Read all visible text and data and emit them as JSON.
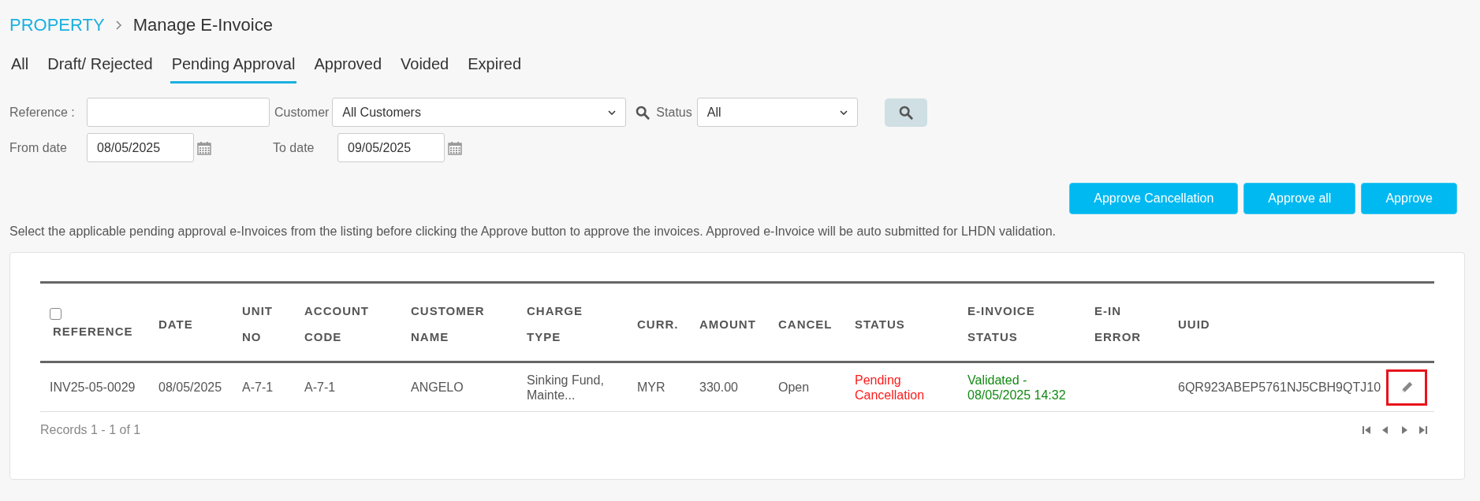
{
  "breadcrumb": {
    "root": "PROPERTY",
    "title": "Manage E-Invoice"
  },
  "tabs": [
    {
      "label": "All",
      "selected": false
    },
    {
      "label": "Draft/ Rejected",
      "selected": false
    },
    {
      "label": "Pending Approval",
      "selected": true
    },
    {
      "label": "Approved",
      "selected": false
    },
    {
      "label": "Voided",
      "selected": false
    },
    {
      "label": "Expired",
      "selected": false
    }
  ],
  "filters": {
    "reference": {
      "label": "Reference :"
    },
    "customer": {
      "label": "Customer",
      "value": "All Customers"
    },
    "status": {
      "label": "Status",
      "value": "All"
    },
    "from_date": {
      "label": "From date",
      "value": "08/05/2025"
    },
    "to_date": {
      "label": "To date",
      "value": "09/05/2025"
    }
  },
  "actions": [
    "Approve Cancellation",
    "Approve all",
    "Approve"
  ],
  "info_text": "Select the applicable pending approval e-Invoices from the listing before clicking the Approve button to approve the invoices. Approved e-Invoice will be auto submitted for LHDN validation.",
  "table": {
    "select_all": {
      "checked": false
    },
    "columns": [
      {
        "lines": [
          "REFERENCE"
        ]
      },
      {
        "lines": [
          "DATE"
        ]
      },
      {
        "lines": [
          "UNIT",
          "NO"
        ]
      },
      {
        "lines": [
          "ACCOUNT",
          "CODE"
        ]
      },
      {
        "lines": [
          "CUSTOMER",
          "NAME"
        ]
      },
      {
        "lines": [
          "CHARGE",
          "TYPE"
        ]
      },
      {
        "lines": [
          "CURR."
        ]
      },
      {
        "lines": [
          "AMOUNT"
        ]
      },
      {
        "lines": [
          "CANCEL"
        ]
      },
      {
        "lines": [
          "STATUS"
        ]
      },
      {
        "lines": [
          "E-INVOICE",
          "STATUS"
        ]
      },
      {
        "lines": [
          "E-IN",
          "ERROR"
        ]
      },
      {
        "lines": [
          "UUID"
        ]
      }
    ],
    "rows": [
      {
        "cells": [
          {
            "text": "INV25-05-0029"
          },
          {
            "text": "08/05/2025"
          },
          {
            "text": "A-7-1"
          },
          {
            "text": "A-7-1"
          },
          {
            "text": "ANGELO"
          },
          {
            "text": "Sinking Fund, Mainte..."
          },
          {
            "text": "MYR"
          },
          {
            "text": "330.00"
          },
          {
            "text": "Open"
          },
          {
            "text": "Pending Cancellation",
            "color": "#ff1a1a"
          },
          {
            "text": "Validated - 08/05/2025 14:32",
            "color": "#138a13"
          },
          {},
          {
            "text": "6QR923ABEP5761NJ5CBH9QTJ10"
          }
        ],
        "edit_highlighted": true
      }
    ]
  },
  "footer": {
    "records": "Records 1 - 1 of 1"
  }
}
